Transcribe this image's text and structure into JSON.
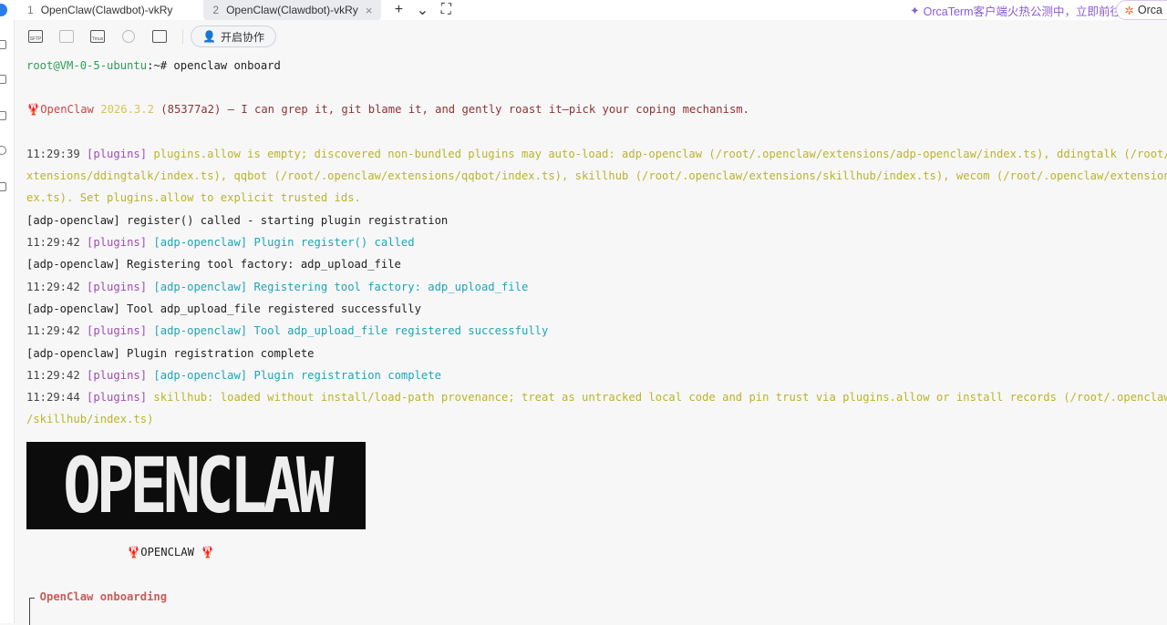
{
  "tabs": [
    {
      "num": "1",
      "label": "OpenClaw(Clawdbot)-vkRy",
      "active": false
    },
    {
      "num": "2",
      "label": "OpenClaw(Clawdbot)-vkRy",
      "active": true
    }
  ],
  "tab_close": "×",
  "tab_actions": {
    "add": "+",
    "menu": "⌄",
    "fullscreen": "⛶"
  },
  "promo": {
    "text": "OrcaTerm客户端火热公测中，立即前往",
    "button": "Orca"
  },
  "toolbar": {
    "sftp": "SFTP",
    "tmux": "Tmux",
    "collab": "开启协作"
  },
  "lines": [
    {
      "segs": [
        [
          "root@VM-0-5-ubuntu",
          "green"
        ],
        [
          ":~# openclaw onboard",
          "blk"
        ]
      ]
    },
    {
      "segs": [
        [
          "🦞",
          "red"
        ],
        [
          "OpenClaw ",
          "red"
        ],
        [
          "2026.3.2 ",
          "ver"
        ],
        [
          "(85377a2) — I can grep it, git blame it, and gently roast it—pick your coping mechanism.",
          "brown"
        ]
      ]
    },
    {
      "segs": [
        [
          "11:29:39 ",
          "ts"
        ],
        [
          "[plugins] ",
          "purple"
        ],
        [
          "plugins.allow is empty; discovered non-bundled plugins may auto-load: adp-openclaw (/root/.openclaw/extensions/adp-openclaw/index.ts), ddingtalk (/root/.ope",
          "yellow"
        ]
      ]
    },
    {
      "segs": [
        [
          "xtensions/ddingtalk/index.ts), qqbot (/root/.openclaw/extensions/qqbot/index.ts), skillhub (/root/.openclaw/extensions/skillhub/index.ts), wecom (/root/.openclaw/extensions/we",
          "yellow"
        ]
      ]
    },
    {
      "segs": [
        [
          "ex.ts). Set plugins.allow to explicit trusted ids.",
          "yellow"
        ]
      ]
    },
    {
      "segs": [
        [
          "[adp-openclaw] register() called - starting plugin registration",
          "blk"
        ]
      ]
    },
    {
      "segs": [
        [
          "11:29:42 ",
          "ts"
        ],
        [
          "[plugins] ",
          "purple"
        ],
        [
          "[adp-openclaw] Plugin register() called",
          "cyan"
        ]
      ]
    },
    {
      "segs": [
        [
          "[adp-openclaw] Registering tool factory: adp_upload_file",
          "blk"
        ]
      ]
    },
    {
      "segs": [
        [
          "11:29:42 ",
          "ts"
        ],
        [
          "[plugins] ",
          "purple"
        ],
        [
          "[adp-openclaw] Registering tool factory: adp_upload_file",
          "cyan"
        ]
      ]
    },
    {
      "segs": [
        [
          "[adp-openclaw] Tool adp_upload_file registered successfully",
          "blk"
        ]
      ]
    },
    {
      "segs": [
        [
          "11:29:42 ",
          "ts"
        ],
        [
          "[plugins] ",
          "purple"
        ],
        [
          "[adp-openclaw] Tool adp_upload_file registered successfully",
          "cyan"
        ]
      ]
    },
    {
      "segs": [
        [
          "[adp-openclaw] Plugin registration complete",
          "blk"
        ]
      ]
    },
    {
      "segs": [
        [
          "11:29:42 ",
          "ts"
        ],
        [
          "[plugins] ",
          "purple"
        ],
        [
          "[adp-openclaw] Plugin registration complete",
          "cyan"
        ]
      ]
    },
    {
      "segs": [
        [
          "11:29:44 ",
          "ts"
        ],
        [
          "[plugins] ",
          "purple"
        ],
        [
          "skillhub: loaded without install/load-path provenance; treat as untracked local code and pin trust via plugins.allow or install records (/root/.openclaw/ext",
          "yellow"
        ]
      ]
    },
    {
      "segs": [
        [
          "/skillhub/index.ts)",
          "yellow"
        ]
      ]
    },
    {
      "segs": [
        [
          "               🦞",
          "red"
        ],
        [
          "OPENCLAW ",
          "blk"
        ],
        [
          "🦞",
          "red"
        ]
      ]
    },
    {
      "segs": [
        [
          "  OpenClaw onboarding",
          "onb"
        ]
      ]
    }
  ],
  "logo_text": "OPENCLAW"
}
